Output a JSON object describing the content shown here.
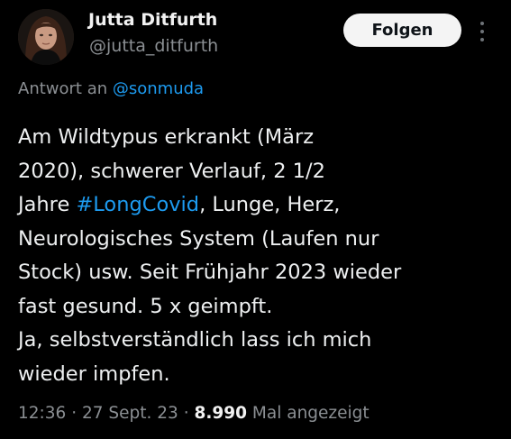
{
  "user": {
    "name": "Jutta Ditfurth",
    "handle": "@jutta_ditfurth"
  },
  "follow_label": "Folgen",
  "more_icon": "more-vertical-icon",
  "reply": {
    "prefix": "Antwort an",
    "mention": "@sonmuda"
  },
  "body": {
    "line1": "Am Wildtypus erkrankt (März",
    "line2": "2020), schwerer Verlauf, 2 1/2",
    "line3_pre": "Jahre ",
    "hashtag": "#LongCovid",
    "line3_post": ", Lunge, Herz,",
    "line4": "Neurologisches System (Laufen nur",
    "line5": "Stock) usw. Seit Frühjahr 2023 wieder",
    "line6": "fast gesund. 5 x geimpft.",
    "line7": "Ja, selbstverständlich lass ich mich",
    "line8": "wieder impfen."
  },
  "meta": {
    "time": "12:36",
    "sep1": " · ",
    "date": "27 Sept. 23",
    "sep2": " · ",
    "views_count": "8.990",
    "views_label": " Mal angezeigt"
  },
  "colors": {
    "background": "#000000",
    "link": "#1d9bf0",
    "secondary_text": "#8b8f93",
    "button_bg": "#f4f4f4"
  }
}
